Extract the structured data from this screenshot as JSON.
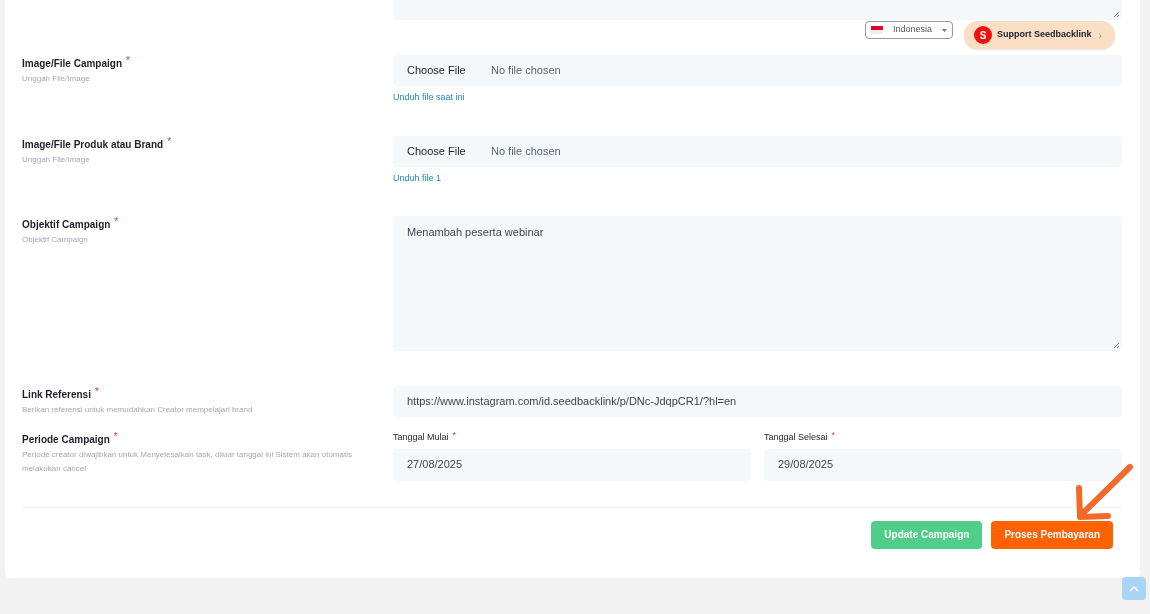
{
  "language_selector": {
    "value": "Indonesia"
  },
  "support_button": {
    "badge": "S",
    "label": "Support Seedbacklink",
    "chevron": "›"
  },
  "fields": [
    {
      "kind": "file",
      "label": "Image/File Campaign",
      "required_mark": "*",
      "hint": "Unggah File/Image",
      "button": "Choose File",
      "status": "No file chosen",
      "link": "Unduh file saat ini"
    },
    {
      "kind": "file",
      "label": "Image/File Produk atau Brand",
      "required_mark": "*",
      "hint": "Unggah File/Image",
      "button": "Choose File",
      "status": "No file chosen",
      "link": "Unduh file 1"
    },
    {
      "kind": "textarea",
      "label": "Objektif Campaign",
      "required_mark": "*",
      "hint": "Objektif Campaign",
      "value": "Menambah peserta webinar"
    },
    {
      "kind": "text",
      "label": "Link Referensi",
      "required_mark": "*",
      "hint": "Berikan referensi untuk memudahkan Creator mempelajari brand",
      "value": "https://www.instagram.com/id.seedbacklink/p/DNc-JdqpCR1/?hl=en"
    },
    {
      "kind": "dates",
      "label": "Periode Campaign",
      "required_mark": "*",
      "hint": "Periode creator diwajibkan untuk Menyelesaikan task, diluar tanggal ini Sistem akan otomatis melakukan cancel",
      "dates": [
        {
          "label": "Tanggal Mulai",
          "required_mark": "*",
          "value": "27/08/2025"
        },
        {
          "label": "Tanggal Selesai",
          "required_mark": "*",
          "value": "29/08/2025"
        }
      ]
    }
  ],
  "buttons": [
    {
      "kind": "update",
      "label": "Update Campaign"
    },
    {
      "kind": "pay",
      "label": "Proses Pembayaran"
    }
  ]
}
